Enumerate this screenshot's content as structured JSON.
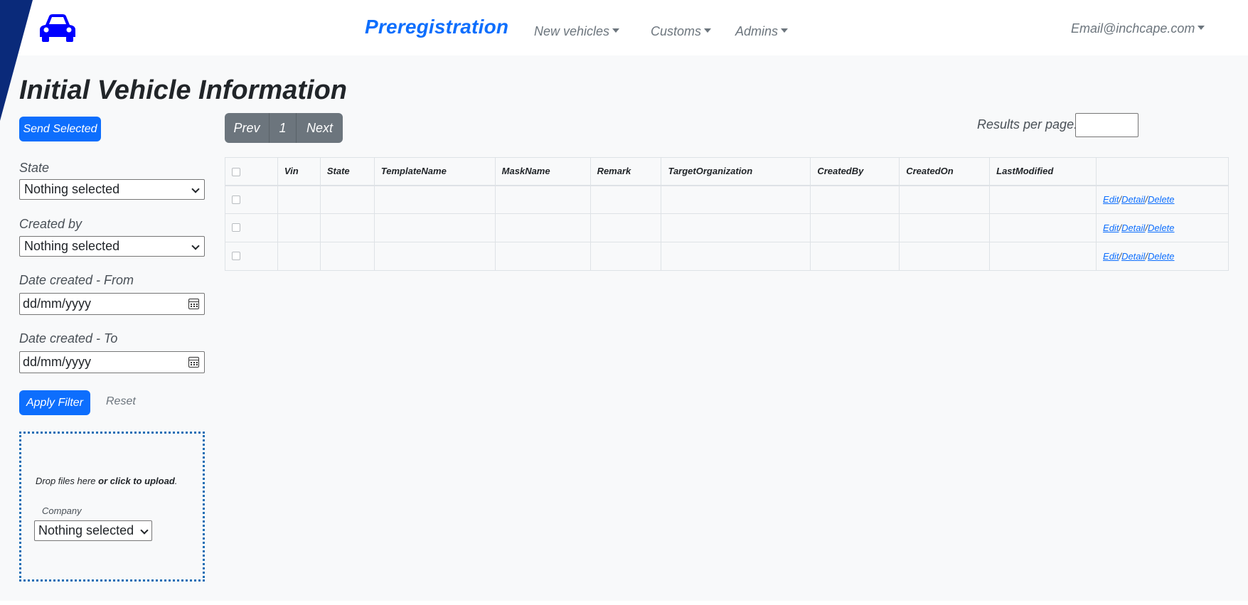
{
  "colors": {
    "accent": "#0d6efd",
    "stripe": "#0a2a7a",
    "car_icon": "#0000ff",
    "muted": "#6c757d"
  },
  "navbar": {
    "logo_icon": "car-icon",
    "brand": "Preregistration",
    "menus": [
      {
        "label": "New vehicles"
      },
      {
        "label": "Customs"
      },
      {
        "label": "Admins"
      }
    ],
    "user_email": "Email@inchcape.com"
  },
  "page_title": "Initial Vehicle Information",
  "send_selected_label": "Send Selected",
  "filters": {
    "state_label": "State",
    "state_value": "Nothing selected",
    "created_by_label": "Created by",
    "created_by_value": "Nothing selected",
    "date_from_label": "Date created - From",
    "date_from_placeholder": "dd/mm/yyyy",
    "date_to_label": "Date created - To",
    "date_to_placeholder": "dd/mm/yyyy",
    "apply_label": "Apply Filter",
    "reset_label": "Reset"
  },
  "upload": {
    "text_plain": "Drop files here ",
    "text_bold": "or click to upload",
    "text_end": ".",
    "company_label": "Company",
    "company_value": "Nothing selected"
  },
  "pagination": {
    "prev": "Prev",
    "page": "1",
    "next": "Next"
  },
  "results_per_page_label": "Results per page:",
  "table": {
    "headers": [
      "Vin",
      "State",
      "TemplateName",
      "MaskName",
      "Remark",
      "TargetOrganization",
      "CreatedBy",
      "CreatedOn",
      "LastModified"
    ],
    "rows": [
      {
        "vin": "",
        "state": "",
        "template": "",
        "mask": "",
        "remark": "",
        "target": "",
        "created_by": "",
        "created_on": "",
        "last_modified": ""
      },
      {
        "vin": "",
        "state": "",
        "template": "",
        "mask": "",
        "remark": "",
        "target": "",
        "created_by": "",
        "created_on": "",
        "last_modified": ""
      },
      {
        "vin": "",
        "state": "",
        "template": "",
        "mask": "",
        "remark": "",
        "target": "",
        "created_by": "",
        "created_on": "",
        "last_modified": ""
      }
    ],
    "actions": {
      "edit": "Edit",
      "detail": "Detail",
      "delete": "Delete",
      "sep": "/"
    }
  }
}
